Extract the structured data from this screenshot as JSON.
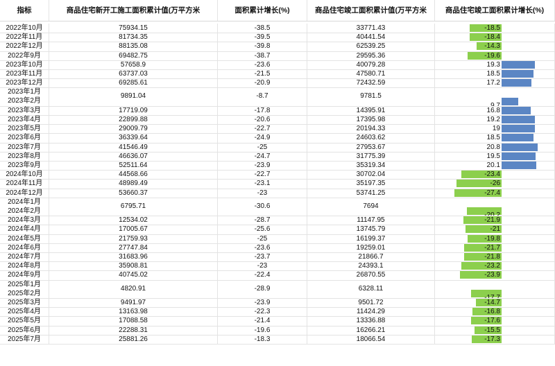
{
  "colors": {
    "negative_bar": "#8ccf4d",
    "positive_bar": "#5b86c4",
    "grid": "#e3e3e3"
  },
  "headers": {
    "indicator": "指标",
    "new_construction_area": "商品住宅新开工施工面积累计值(万平方米",
    "area_growth": "面积累计增长(%)",
    "completed_area": "商品住宅竣工面积累计值(万平方米",
    "completed_growth": "商品住宅竣工面积累计增长(%)"
  },
  "rows": [
    {
      "period": "2022年10月",
      "new_area": "75934.15",
      "new_growth": "-38.5",
      "done_area": "33771.43",
      "done_growth": "-18.5"
    },
    {
      "period": "2022年11月",
      "new_area": "81734.35",
      "new_growth": "-39.5",
      "done_area": "40441.54",
      "done_growth": "-18.4"
    },
    {
      "period": "2022年12月",
      "new_area": "88135.08",
      "new_growth": "-39.8",
      "done_area": "62539.25",
      "done_growth": "-14.3"
    },
    {
      "period": "2022年9月",
      "new_area": "69482.75",
      "new_growth": "-38.7",
      "done_area": "29595.36",
      "done_growth": "-19.6"
    },
    {
      "period": "2023年10月",
      "new_area": "57658.9",
      "new_growth": "-23.6",
      "done_area": "40079.28",
      "done_growth": "19.3"
    },
    {
      "period": "2023年11月",
      "new_area": "63737.03",
      "new_growth": "-21.5",
      "done_area": "47580.71",
      "done_growth": "18.5"
    },
    {
      "period": "2023年12月",
      "new_area": "69285.61",
      "new_growth": "-20.9",
      "done_area": "72432.59",
      "done_growth": "17.2"
    },
    {
      "period": "2023年1月\n2023年2月",
      "new_area": "9891.04",
      "new_growth": "-8.7",
      "done_area": "9781.5",
      "done_growth": "9.7",
      "tall": true
    },
    {
      "period": "2023年3月",
      "new_area": "17719.09",
      "new_growth": "-17.8",
      "done_area": "14395.91",
      "done_growth": "16.8"
    },
    {
      "period": "2023年4月",
      "new_area": "22899.88",
      "new_growth": "-20.6",
      "done_area": "17395.98",
      "done_growth": "19.2"
    },
    {
      "period": "2023年5月",
      "new_area": "29009.79",
      "new_growth": "-22.7",
      "done_area": "20194.33",
      "done_growth": "19"
    },
    {
      "period": "2023年6月",
      "new_area": "36339.64",
      "new_growth": "-24.9",
      "done_area": "24603.62",
      "done_growth": "18.5"
    },
    {
      "period": "2023年7月",
      "new_area": "41546.49",
      "new_growth": "-25",
      "done_area": "27953.67",
      "done_growth": "20.8"
    },
    {
      "period": "2023年8月",
      "new_area": "46636.07",
      "new_growth": "-24.7",
      "done_area": "31775.39",
      "done_growth": "19.5"
    },
    {
      "period": "2023年9月",
      "new_area": "52511.64",
      "new_growth": "-23.9",
      "done_area": "35319.34",
      "done_growth": "20.1"
    },
    {
      "period": "2024年10月",
      "new_area": "44568.66",
      "new_growth": "-22.7",
      "done_area": "30702.04",
      "done_growth": "-23.4"
    },
    {
      "period": "2024年11月",
      "new_area": "48989.49",
      "new_growth": "-23.1",
      "done_area": "35197.35",
      "done_growth": "-26"
    },
    {
      "period": "2024年12月",
      "new_area": "53660.37",
      "new_growth": "-23",
      "done_area": "53741.25",
      "done_growth": "-27.4"
    },
    {
      "period": "2024年1月\n2024年2月",
      "new_area": "6795.71",
      "new_growth": "-30.6",
      "done_area": "7694",
      "done_growth": "-20.2",
      "tall": true
    },
    {
      "period": "2024年3月",
      "new_area": "12534.02",
      "new_growth": "-28.7",
      "done_area": "11147.95",
      "done_growth": "-21.9"
    },
    {
      "period": "2024年4月",
      "new_area": "17005.67",
      "new_growth": "-25.6",
      "done_area": "13745.79",
      "done_growth": "-21"
    },
    {
      "period": "2024年5月",
      "new_area": "21759.93",
      "new_growth": "-25",
      "done_area": "16199.37",
      "done_growth": "-19.8"
    },
    {
      "period": "2024年6月",
      "new_area": "27747.84",
      "new_growth": "-23.6",
      "done_area": "19259.01",
      "done_growth": "-21.7"
    },
    {
      "period": "2024年7月",
      "new_area": "31683.96",
      "new_growth": "-23.7",
      "done_area": "21866.7",
      "done_growth": "-21.8"
    },
    {
      "period": "2024年8月",
      "new_area": "35908.81",
      "new_growth": "-23",
      "done_area": "24393.1",
      "done_growth": "-23.2"
    },
    {
      "period": "2024年9月",
      "new_area": "40745.02",
      "new_growth": "-22.4",
      "done_area": "26870.55",
      "done_growth": "-23.9"
    },
    {
      "period": "2025年1月\n2025年2月",
      "new_area": "4820.91",
      "new_growth": "-28.9",
      "done_area": "6328.11",
      "done_growth": "-17.7",
      "tall": true
    },
    {
      "period": "2025年3月",
      "new_area": "9491.97",
      "new_growth": "-23.9",
      "done_area": "9501.72",
      "done_growth": "-14.7"
    },
    {
      "period": "2025年4月",
      "new_area": "13163.98",
      "new_growth": "-22.3",
      "done_area": "11424.29",
      "done_growth": "-16.8"
    },
    {
      "period": "2025年5月",
      "new_area": "17088.58",
      "new_growth": "-21.4",
      "done_area": "13336.88",
      "done_growth": "-17.6"
    },
    {
      "period": "2025年6月",
      "new_area": "22288.31",
      "new_growth": "-19.6",
      "done_area": "16266.21",
      "done_growth": "-15.5"
    },
    {
      "period": "2025年7月",
      "new_area": "25881.26",
      "new_growth": "-18.3",
      "done_area": "18066.54",
      "done_growth": "-17.3"
    }
  ]
}
